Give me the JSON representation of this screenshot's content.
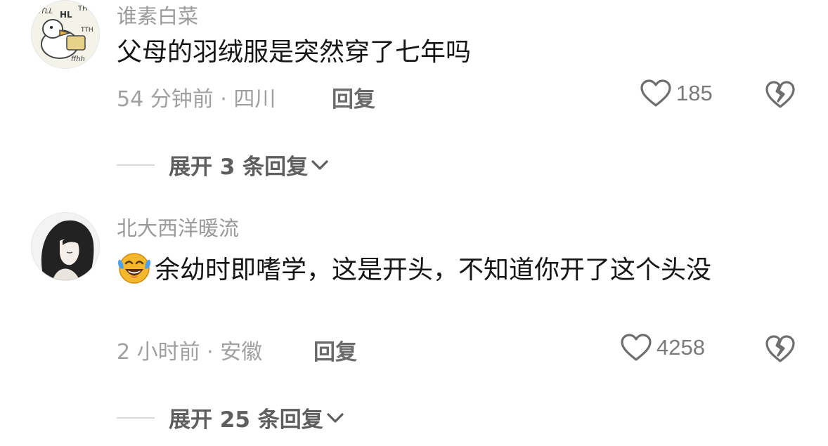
{
  "comments": [
    {
      "username": "谁素白菜",
      "text": "父母的羽绒服是突然穿了七年吗",
      "meta": "54 分钟前 · 四川",
      "reply_label": "回复",
      "likes": "185",
      "expand_label": "展开 3 条回复"
    },
    {
      "username": "北大西洋暖流",
      "emoji": "laughing-crying-emoji",
      "text": "余幼时即嗜学，这是开头，不知道你开了这个头没",
      "meta": "2 小时前 · 安徽",
      "reply_label": "回复",
      "likes": "4258",
      "expand_label": "展开 25 条回复"
    }
  ],
  "icons": {
    "like": "heart-outline-icon",
    "dislike": "broken-heart-icon",
    "expand": "chevron-down-icon"
  },
  "colors": {
    "username": "#9a9a9a",
    "text": "#161616",
    "meta": "#a0a0a0",
    "reply": "#6b6b6b",
    "icon": "#6e6e6e"
  }
}
